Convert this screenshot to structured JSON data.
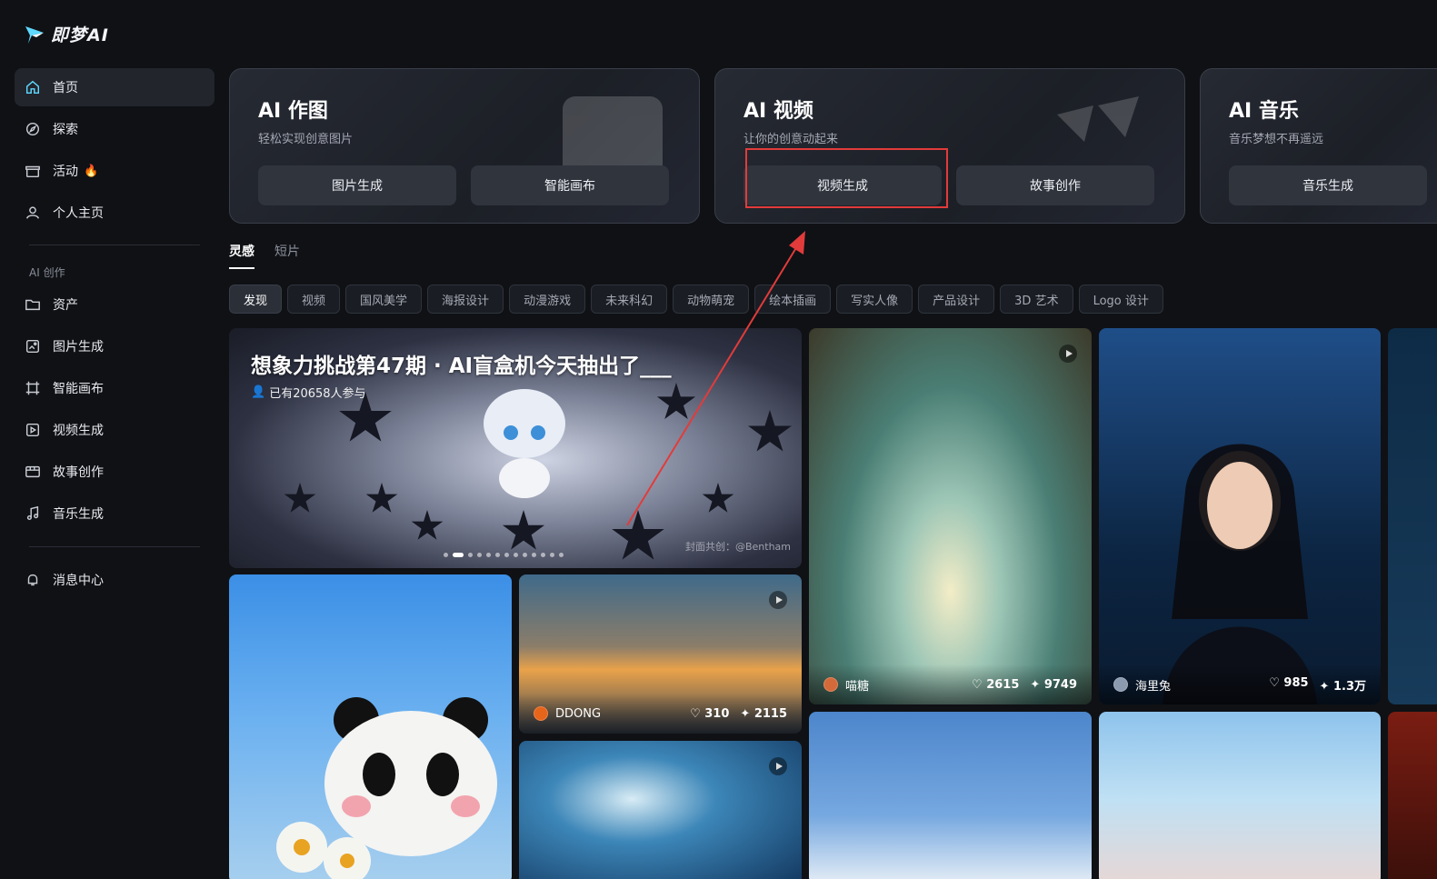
{
  "brand": {
    "name": "即梦AI",
    "accent": "#5fd8ff"
  },
  "sidebar": {
    "main": [
      {
        "label": "首页",
        "icon": "home-icon",
        "active": true
      },
      {
        "label": "探索",
        "icon": "compass-icon"
      },
      {
        "label": "活动",
        "icon": "gift-icon",
        "badge": "fire-icon"
      },
      {
        "label": "个人主页",
        "icon": "user-icon"
      }
    ],
    "section_label": "AI 创作",
    "create": [
      {
        "label": "资产",
        "icon": "folder-icon"
      },
      {
        "label": "图片生成",
        "icon": "image-gen-icon"
      },
      {
        "label": "智能画布",
        "icon": "canvas-icon"
      },
      {
        "label": "视频生成",
        "icon": "video-gen-icon"
      },
      {
        "label": "故事创作",
        "icon": "story-icon"
      },
      {
        "label": "音乐生成",
        "icon": "music-icon"
      }
    ],
    "bottom": [
      {
        "label": "消息中心",
        "icon": "bell-icon"
      }
    ]
  },
  "cards": [
    {
      "title": "AI 作图",
      "subtitle": "轻松实现创意图片",
      "buttons": [
        "图片生成",
        "智能画布"
      ]
    },
    {
      "title": "AI 视频",
      "subtitle": "让你的创意动起来",
      "buttons": [
        "视频生成",
        "故事创作"
      ]
    },
    {
      "title": "AI 音乐",
      "subtitle": "音乐梦想不再遥远",
      "buttons": [
        "音乐生成"
      ]
    }
  ],
  "tabs": [
    "灵感",
    "短片"
  ],
  "chips": [
    "发现",
    "视频",
    "国风美学",
    "海报设计",
    "动漫游戏",
    "未来科幻",
    "动物萌宠",
    "绘本插画",
    "写实人像",
    "产品设计",
    "3D 艺术",
    "Logo 设计"
  ],
  "banner": {
    "title": "想象力挑战第47期 · AI盲盒机今天抽出了___",
    "participants": "已有20658人参与",
    "credit": "封面共创：@Bentham"
  },
  "works": [
    {
      "id": "silk",
      "author": "喵糖",
      "likes": "2615",
      "uses": "9749"
    },
    {
      "id": "girl",
      "author": "海里兔",
      "likes": "985",
      "uses": "1.3万"
    },
    {
      "id": "sunset",
      "author": "DDONG",
      "likes": "310",
      "uses": "2115"
    }
  ],
  "colors": {
    "highlight": "#e23b3b",
    "background": "#0f1115"
  }
}
